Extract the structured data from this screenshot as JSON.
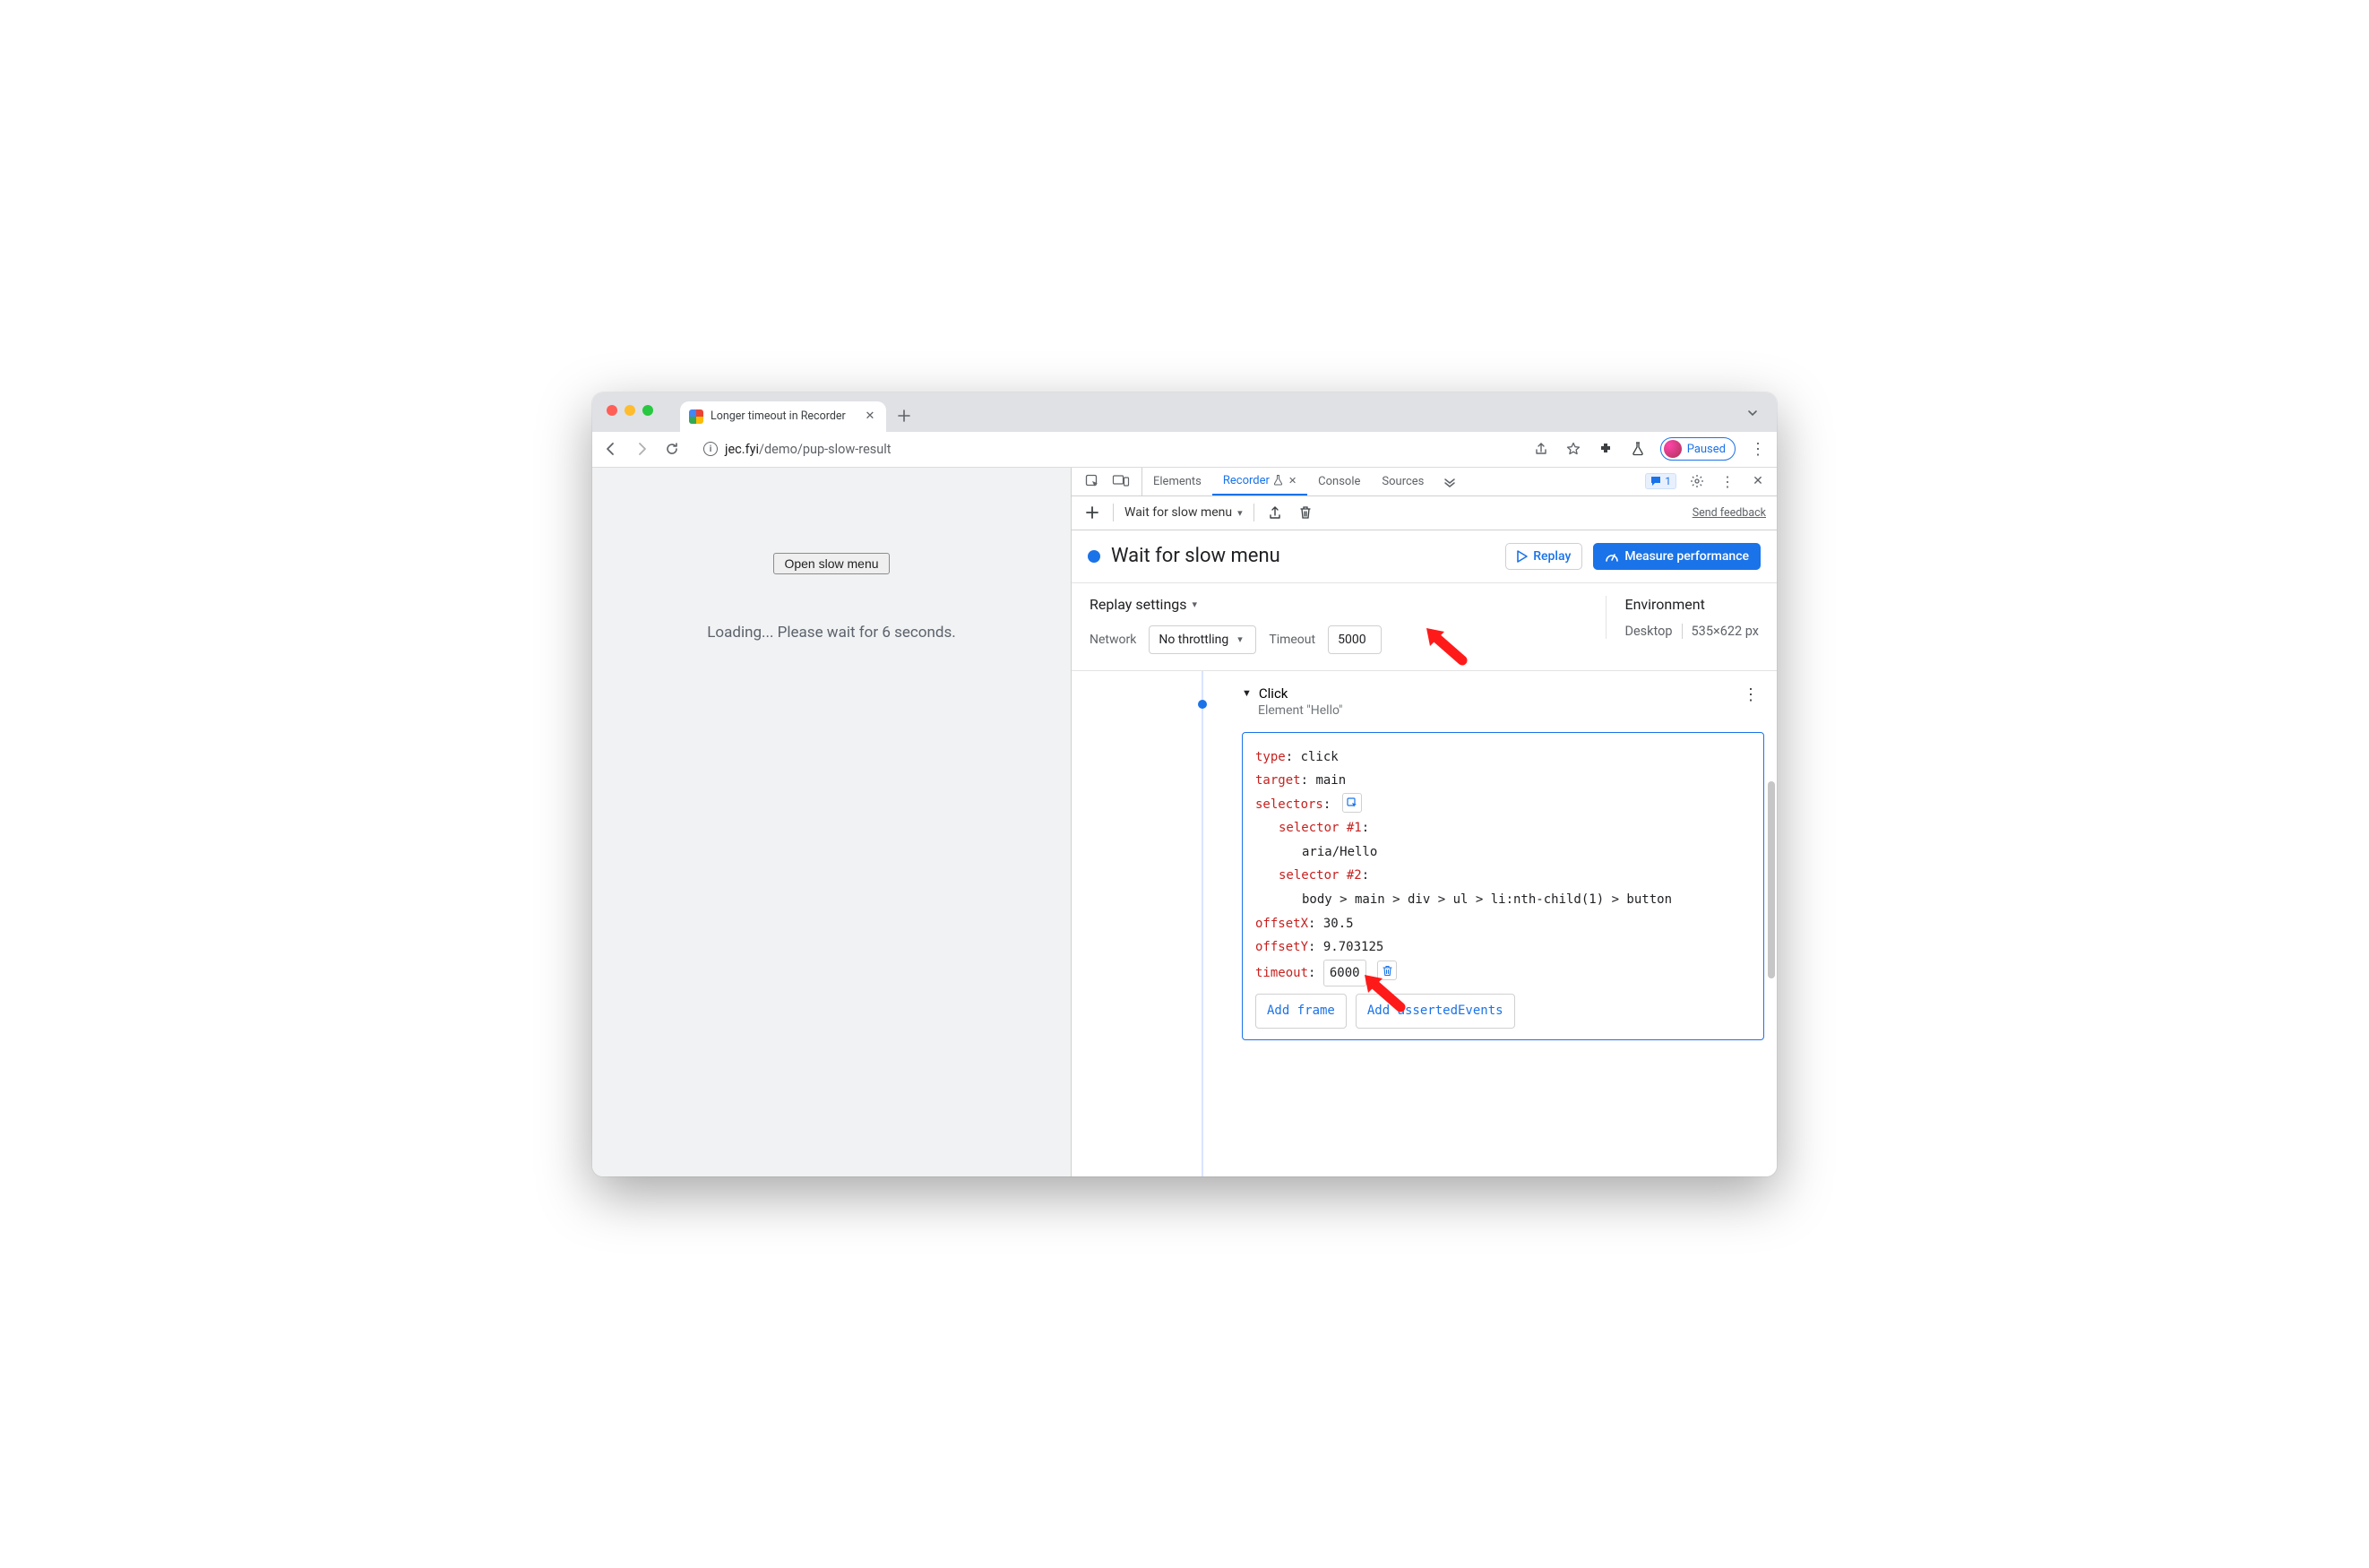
{
  "browser": {
    "tab_title": "Longer timeout in Recorder",
    "url_host": "jec.fyi",
    "url_path": "/demo/pup-slow-result",
    "profile_state": "Paused"
  },
  "page": {
    "button_label": "Open slow menu",
    "loading_text": "Loading... Please wait for 6 seconds."
  },
  "devtools": {
    "tabs": {
      "elements": "Elements",
      "recorder": "Recorder",
      "console": "Console",
      "sources": "Sources"
    },
    "issue_count": "1",
    "recorder": {
      "flow_select": "Wait for slow menu",
      "send_feedback": "Send feedback",
      "flow_title": "Wait for slow menu",
      "replay_btn": "Replay",
      "measure_btn": "Measure performance",
      "settings": {
        "title": "Replay settings",
        "network_label": "Network",
        "throttling_value": "No throttling",
        "timeout_label": "Timeout",
        "timeout_value": "5000"
      },
      "env": {
        "title": "Environment",
        "device": "Desktop",
        "viewport": "535×622 px"
      },
      "step": {
        "name": "Click",
        "subtitle": "Element \"Hello\"",
        "type_key": "type",
        "type_val": "click",
        "target_key": "target",
        "target_val": "main",
        "selectors_key": "selectors",
        "sel1_key": "selector #1",
        "sel1_val": "aria/Hello",
        "sel2_key": "selector #2",
        "sel2_val": "body > main > div > ul > li:nth-child(1) > button",
        "offx_key": "offsetX",
        "offx_val": "30.5",
        "offy_key": "offsetY",
        "offy_val": "9.703125",
        "timeout_key": "timeout",
        "timeout_val": "6000",
        "add_frame": "Add frame",
        "add_asserted": "Add assertedEvents"
      }
    }
  }
}
